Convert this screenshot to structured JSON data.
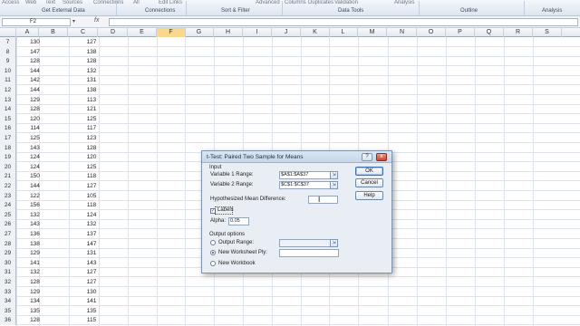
{
  "ribbon": {
    "top_items": [
      "Access",
      "Web",
      "Text",
      "Sources",
      "Connections",
      "All",
      "Edit Links",
      "Advanced",
      "Columns",
      "Duplicates",
      "Validation",
      "Analysis"
    ],
    "groups": [
      "Get External Data",
      "Connections",
      "Sort & Filter",
      "Data Tools",
      "Outline",
      "Analysis"
    ]
  },
  "formula_bar": {
    "name_box": "F2",
    "fx_label": "fx",
    "formula": ""
  },
  "grid": {
    "columns": [
      "A",
      "B",
      "C",
      "D",
      "E",
      "F",
      "G",
      "H",
      "I",
      "J",
      "K",
      "L",
      "M",
      "N",
      "O",
      "P",
      "Q",
      "R",
      "S"
    ],
    "selected_column": "F",
    "rows": [
      {
        "n": "7",
        "a": "130",
        "c": "127"
      },
      {
        "n": "8",
        "a": "147",
        "c": "138"
      },
      {
        "n": "9",
        "a": "128",
        "c": "128"
      },
      {
        "n": "10",
        "a": "144",
        "c": "132"
      },
      {
        "n": "11",
        "a": "142",
        "c": "131"
      },
      {
        "n": "12",
        "a": "144",
        "c": "138"
      },
      {
        "n": "13",
        "a": "129",
        "c": "113"
      },
      {
        "n": "14",
        "a": "128",
        "c": "121"
      },
      {
        "n": "15",
        "a": "120",
        "c": "125"
      },
      {
        "n": "16",
        "a": "114",
        "c": "117"
      },
      {
        "n": "17",
        "a": "125",
        "c": "123"
      },
      {
        "n": "18",
        "a": "143",
        "c": "128"
      },
      {
        "n": "19",
        "a": "124",
        "c": "120"
      },
      {
        "n": "20",
        "a": "124",
        "c": "125"
      },
      {
        "n": "21",
        "a": "150",
        "c": "118"
      },
      {
        "n": "22",
        "a": "144",
        "c": "127"
      },
      {
        "n": "23",
        "a": "122",
        "c": "105"
      },
      {
        "n": "24",
        "a": "156",
        "c": "118"
      },
      {
        "n": "25",
        "a": "132",
        "c": "124"
      },
      {
        "n": "26",
        "a": "143",
        "c": "132"
      },
      {
        "n": "27",
        "a": "136",
        "c": "137"
      },
      {
        "n": "28",
        "a": "138",
        "c": "147"
      },
      {
        "n": "29",
        "a": "129",
        "c": "131"
      },
      {
        "n": "30",
        "a": "141",
        "c": "143"
      },
      {
        "n": "31",
        "a": "132",
        "c": "127"
      },
      {
        "n": "32",
        "a": "128",
        "c": "127"
      },
      {
        "n": "33",
        "a": "129",
        "c": "130"
      },
      {
        "n": "34",
        "a": "134",
        "c": "141"
      },
      {
        "n": "35",
        "a": "135",
        "c": "135"
      },
      {
        "n": "36",
        "a": "128",
        "c": "115"
      }
    ]
  },
  "dialog": {
    "title": "t-Test: Paired Two Sample for Means",
    "help_glyph": "?",
    "close_glyph": "x",
    "input_section": "Input",
    "var1_label": "Variable 1 Range:",
    "var1_value": "$A$1:$A$37",
    "var2_label": "Variable 2 Range:",
    "var2_value": "$C$1:$C$37",
    "hyp_label": "Hypothesized Mean Difference:",
    "hyp_value": "",
    "labels_label": "Labels",
    "labels_checked": true,
    "alpha_label": "Alpha:",
    "alpha_value": "0.05",
    "output_section": "Output options",
    "output_range_label": "Output Range:",
    "new_ply_label": "New Worksheet Ply:",
    "new_workbook_label": "New Workbook",
    "selected_output": "new_ply",
    "ok_label": "OK",
    "cancel_label": "Cancel",
    "help_label": "Help"
  },
  "colors": {
    "ribbon_bg": "#dde6f1",
    "selected_column": "#f9d88b",
    "dialog_bg": "#e9eef5",
    "close_button": "#c9432e"
  }
}
